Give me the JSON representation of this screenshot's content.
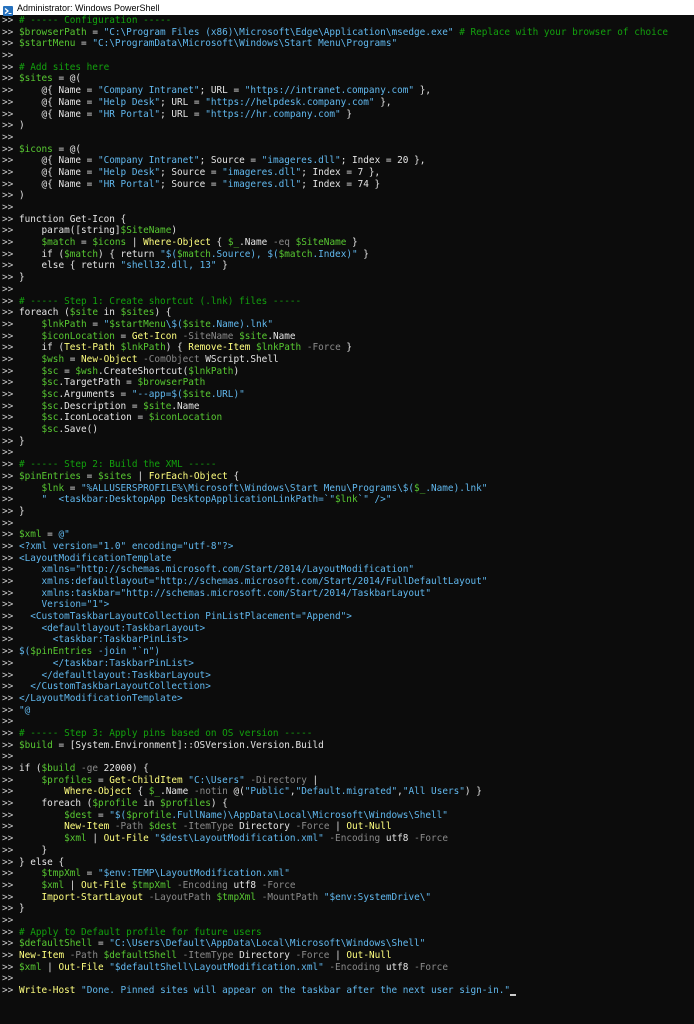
{
  "window": {
    "title": "Administrator: Windows PowerShell",
    "icon": "powershell-icon"
  },
  "console": {
    "prompt": ">> ",
    "lines": [
      [
        [
          "c",
          "# ----- Configuration -----"
        ]
      ],
      [
        [
          "v",
          "$browserPath"
        ],
        [
          "t",
          " = "
        ],
        [
          "s",
          "\"C:\\Program Files (x86)\\Microsoft\\Edge\\Application\\msedge.exe\""
        ],
        [
          "t",
          " "
        ],
        [
          "c",
          "# Replace with your browser of choice"
        ]
      ],
      [
        [
          "v",
          "$startMenu"
        ],
        [
          "t",
          " = "
        ],
        [
          "s",
          "\"C:\\ProgramData\\Microsoft\\Windows\\Start Menu\\Programs\""
        ]
      ],
      [],
      [
        [
          "c",
          "# Add sites here"
        ]
      ],
      [
        [
          "v",
          "$sites"
        ],
        [
          "t",
          " = @("
        ]
      ],
      [
        [
          "t",
          "    @{ Name = "
        ],
        [
          "s",
          "\"Company Intranet\""
        ],
        [
          "t",
          "; URL = "
        ],
        [
          "s",
          "\"https://intranet.company.com\""
        ],
        [
          "t",
          " },"
        ]
      ],
      [
        [
          "t",
          "    @{ Name = "
        ],
        [
          "s",
          "\"Help Desk\""
        ],
        [
          "t",
          "; URL = "
        ],
        [
          "s",
          "\"https://helpdesk.company.com\""
        ],
        [
          "t",
          " },"
        ]
      ],
      [
        [
          "t",
          "    @{ Name = "
        ],
        [
          "s",
          "\"HR Portal\""
        ],
        [
          "t",
          "; URL = "
        ],
        [
          "s",
          "\"https://hr.company.com\""
        ],
        [
          "t",
          " }"
        ]
      ],
      [
        [
          "t",
          ")"
        ]
      ],
      [],
      [
        [
          "v",
          "$icons"
        ],
        [
          "t",
          " = @("
        ]
      ],
      [
        [
          "t",
          "    @{ Name = "
        ],
        [
          "s",
          "\"Company Intranet\""
        ],
        [
          "t",
          "; Source = "
        ],
        [
          "s",
          "\"imageres.dll\""
        ],
        [
          "t",
          "; Index = 20 },"
        ]
      ],
      [
        [
          "t",
          "    @{ Name = "
        ],
        [
          "s",
          "\"Help Desk\""
        ],
        [
          "t",
          "; Source = "
        ],
        [
          "s",
          "\"imageres.dll\""
        ],
        [
          "t",
          "; Index = 7 },"
        ]
      ],
      [
        [
          "t",
          "    @{ Name = "
        ],
        [
          "s",
          "\"HR Portal\""
        ],
        [
          "t",
          "; Source = "
        ],
        [
          "s",
          "\"imageres.dll\""
        ],
        [
          "t",
          "; Index = 74 }"
        ]
      ],
      [
        [
          "t",
          ")"
        ]
      ],
      [],
      [
        [
          "t",
          "function Get-Icon {"
        ]
      ],
      [
        [
          "t",
          "    param([string]"
        ],
        [
          "v",
          "$SiteName"
        ],
        [
          "t",
          ")"
        ]
      ],
      [
        [
          "t",
          "    "
        ],
        [
          "v",
          "$match"
        ],
        [
          "t",
          " = "
        ],
        [
          "v",
          "$icons"
        ],
        [
          "t",
          " | "
        ],
        [
          "k",
          "Where-Object"
        ],
        [
          "t",
          " { "
        ],
        [
          "v",
          "$_"
        ],
        [
          "t",
          ".Name "
        ],
        [
          "n",
          "-eq"
        ],
        [
          "t",
          " "
        ],
        [
          "v",
          "$SiteName"
        ],
        [
          "t",
          " }"
        ]
      ],
      [
        [
          "t",
          "    if ("
        ],
        [
          "v",
          "$match"
        ],
        [
          "t",
          ") { return "
        ],
        [
          "s",
          "\"$("
        ],
        [
          "v",
          "$match"
        ],
        [
          "s",
          ".Source), $("
        ],
        [
          "v",
          "$match"
        ],
        [
          "s",
          ".Index)\""
        ],
        [
          "t",
          " }"
        ]
      ],
      [
        [
          "t",
          "    else { return "
        ],
        [
          "s",
          "\"shell32.dll, 13\""
        ],
        [
          "t",
          " }"
        ]
      ],
      [
        [
          "t",
          "}"
        ]
      ],
      [],
      [
        [
          "c",
          "# ----- Step 1: Create shortcut (.lnk) files -----"
        ]
      ],
      [
        [
          "t",
          "foreach ("
        ],
        [
          "v",
          "$site"
        ],
        [
          "t",
          " in "
        ],
        [
          "v",
          "$sites"
        ],
        [
          "t",
          ") {"
        ]
      ],
      [
        [
          "t",
          "    "
        ],
        [
          "v",
          "$lnkPath"
        ],
        [
          "t",
          " = "
        ],
        [
          "s",
          "\""
        ],
        [
          "v",
          "$startMenu"
        ],
        [
          "s",
          "\\$("
        ],
        [
          "v",
          "$site"
        ],
        [
          "s",
          ".Name).lnk\""
        ]
      ],
      [
        [
          "t",
          "    "
        ],
        [
          "v",
          "$iconLocation"
        ],
        [
          "t",
          " = "
        ],
        [
          "k",
          "Get-Icon"
        ],
        [
          "t",
          " "
        ],
        [
          "n",
          "-SiteName"
        ],
        [
          "t",
          " "
        ],
        [
          "v",
          "$site"
        ],
        [
          "t",
          ".Name"
        ]
      ],
      [
        [
          "t",
          "    if ("
        ],
        [
          "k",
          "Test-Path"
        ],
        [
          "t",
          " "
        ],
        [
          "v",
          "$lnkPath"
        ],
        [
          "t",
          ") { "
        ],
        [
          "k",
          "Remove-Item"
        ],
        [
          "t",
          " "
        ],
        [
          "v",
          "$lnkPath"
        ],
        [
          "t",
          " "
        ],
        [
          "n",
          "-Force"
        ],
        [
          "t",
          " }"
        ]
      ],
      [
        [
          "t",
          "    "
        ],
        [
          "v",
          "$wsh"
        ],
        [
          "t",
          " = "
        ],
        [
          "k",
          "New-Object"
        ],
        [
          "t",
          " "
        ],
        [
          "n",
          "-ComObject"
        ],
        [
          "t",
          " WScript.Shell"
        ]
      ],
      [
        [
          "t",
          "    "
        ],
        [
          "v",
          "$sc"
        ],
        [
          "t",
          " = "
        ],
        [
          "v",
          "$wsh"
        ],
        [
          "t",
          ".CreateShortcut("
        ],
        [
          "v",
          "$lnkPath"
        ],
        [
          "t",
          ")"
        ]
      ],
      [
        [
          "t",
          "    "
        ],
        [
          "v",
          "$sc"
        ],
        [
          "t",
          ".TargetPath = "
        ],
        [
          "v",
          "$browserPath"
        ]
      ],
      [
        [
          "t",
          "    "
        ],
        [
          "v",
          "$sc"
        ],
        [
          "t",
          ".Arguments = "
        ],
        [
          "s",
          "\"--app=$("
        ],
        [
          "v",
          "$site"
        ],
        [
          "s",
          ".URL)\""
        ]
      ],
      [
        [
          "t",
          "    "
        ],
        [
          "v",
          "$sc"
        ],
        [
          "t",
          ".Description = "
        ],
        [
          "v",
          "$site"
        ],
        [
          "t",
          ".Name"
        ]
      ],
      [
        [
          "t",
          "    "
        ],
        [
          "v",
          "$sc"
        ],
        [
          "t",
          ".IconLocation = "
        ],
        [
          "v",
          "$iconLocation"
        ]
      ],
      [
        [
          "t",
          "    "
        ],
        [
          "v",
          "$sc"
        ],
        [
          "t",
          ".Save()"
        ]
      ],
      [
        [
          "t",
          "}"
        ]
      ],
      [],
      [
        [
          "c",
          "# ----- Step 2: Build the XML -----"
        ]
      ],
      [
        [
          "v",
          "$pinEntries"
        ],
        [
          "t",
          " = "
        ],
        [
          "v",
          "$sites"
        ],
        [
          "t",
          " | "
        ],
        [
          "k",
          "ForEach-Object"
        ],
        [
          "t",
          " {"
        ]
      ],
      [
        [
          "t",
          "    "
        ],
        [
          "v",
          "$lnk"
        ],
        [
          "t",
          " = "
        ],
        [
          "s",
          "\"%ALLUSERSPROFILE%\\Microsoft\\Windows\\Start Menu\\Programs\\$("
        ],
        [
          "v",
          "$_"
        ],
        [
          "s",
          ".Name).lnk\""
        ]
      ],
      [
        [
          "t",
          "    "
        ],
        [
          "s",
          "\"  <taskbar:DesktopApp DesktopApplicationLinkPath=`\""
        ],
        [
          "v",
          "$lnk"
        ],
        [
          "s",
          "`\" />\""
        ]
      ],
      [
        [
          "t",
          "}"
        ]
      ],
      [],
      [
        [
          "v",
          "$xml"
        ],
        [
          "t",
          " = "
        ],
        [
          "s",
          "@\""
        ]
      ],
      [
        [
          "s",
          "<?xml version=\"1.0\" encoding=\"utf-8\"?>"
        ]
      ],
      [
        [
          "s",
          "<LayoutModificationTemplate"
        ]
      ],
      [
        [
          "s",
          "    xmlns=\"http://schemas.microsoft.com/Start/2014/LayoutModification\""
        ]
      ],
      [
        [
          "s",
          "    xmlns:defaultlayout=\"http://schemas.microsoft.com/Start/2014/FullDefaultLayout\""
        ]
      ],
      [
        [
          "s",
          "    xmlns:taskbar=\"http://schemas.microsoft.com/Start/2014/TaskbarLayout\""
        ]
      ],
      [
        [
          "s",
          "    Version=\"1\">"
        ]
      ],
      [
        [
          "s",
          "  <CustomTaskbarLayoutCollection PinListPlacement=\"Append\">"
        ]
      ],
      [
        [
          "s",
          "    <defaultlayout:TaskbarLayout>"
        ]
      ],
      [
        [
          "s",
          "      <taskbar:TaskbarPinList>"
        ]
      ],
      [
        [
          "s",
          "$("
        ],
        [
          "v",
          "$pinEntries"
        ],
        [
          "s",
          " -join \"`n\")"
        ]
      ],
      [
        [
          "s",
          "      </taskbar:TaskbarPinList>"
        ]
      ],
      [
        [
          "s",
          "    </defaultlayout:TaskbarLayout>"
        ]
      ],
      [
        [
          "s",
          "  </CustomTaskbarLayoutCollection>"
        ]
      ],
      [
        [
          "s",
          "</LayoutModificationTemplate>"
        ]
      ],
      [
        [
          "s",
          "\"@"
        ]
      ],
      [],
      [
        [
          "c",
          "# ----- Step 3: Apply pins based on OS version -----"
        ]
      ],
      [
        [
          "v",
          "$build"
        ],
        [
          "t",
          " = [System.Environment]::OSVersion.Version.Build"
        ]
      ],
      [],
      [
        [
          "t",
          "if ("
        ],
        [
          "v",
          "$build"
        ],
        [
          "t",
          " "
        ],
        [
          "n",
          "-ge"
        ],
        [
          "t",
          " 22000) {"
        ]
      ],
      [
        [
          "t",
          "    "
        ],
        [
          "v",
          "$profiles"
        ],
        [
          "t",
          " = "
        ],
        [
          "k",
          "Get-ChildItem"
        ],
        [
          "t",
          " "
        ],
        [
          "s",
          "\"C:\\Users\""
        ],
        [
          "t",
          " "
        ],
        [
          "n",
          "-Directory"
        ],
        [
          "t",
          " |"
        ]
      ],
      [
        [
          "t",
          "        "
        ],
        [
          "k",
          "Where-Object"
        ],
        [
          "t",
          " { "
        ],
        [
          "v",
          "$_"
        ],
        [
          "t",
          ".Name "
        ],
        [
          "n",
          "-notin"
        ],
        [
          "t",
          " @("
        ],
        [
          "s",
          "\"Public\""
        ],
        [
          "t",
          ","
        ],
        [
          "s",
          "\"Default.migrated\""
        ],
        [
          "t",
          ","
        ],
        [
          "s",
          "\"All Users\""
        ],
        [
          "t",
          ") }"
        ]
      ],
      [
        [
          "t",
          "    foreach ("
        ],
        [
          "v",
          "$profile"
        ],
        [
          "t",
          " in "
        ],
        [
          "v",
          "$profiles"
        ],
        [
          "t",
          ") {"
        ]
      ],
      [
        [
          "t",
          "        "
        ],
        [
          "v",
          "$dest"
        ],
        [
          "t",
          " = "
        ],
        [
          "s",
          "\"$("
        ],
        [
          "v",
          "$profile"
        ],
        [
          "s",
          ".FullName)\\AppData\\Local\\Microsoft\\Windows\\Shell\""
        ]
      ],
      [
        [
          "t",
          "        "
        ],
        [
          "k",
          "New-Item"
        ],
        [
          "t",
          " "
        ],
        [
          "n",
          "-Path"
        ],
        [
          "t",
          " "
        ],
        [
          "v",
          "$dest"
        ],
        [
          "t",
          " "
        ],
        [
          "n",
          "-ItemType"
        ],
        [
          "t",
          " Directory "
        ],
        [
          "n",
          "-Force"
        ],
        [
          "t",
          " | "
        ],
        [
          "k",
          "Out-Null"
        ]
      ],
      [
        [
          "t",
          "        "
        ],
        [
          "v",
          "$xml"
        ],
        [
          "t",
          " | "
        ],
        [
          "k",
          "Out-File"
        ],
        [
          "t",
          " "
        ],
        [
          "s",
          "\"$dest\\LayoutModification.xml\""
        ],
        [
          "t",
          " "
        ],
        [
          "n",
          "-Encoding"
        ],
        [
          "t",
          " utf8 "
        ],
        [
          "n",
          "-Force"
        ]
      ],
      [
        [
          "t",
          "    }"
        ]
      ],
      [
        [
          "t",
          "} else {"
        ]
      ],
      [
        [
          "t",
          "    "
        ],
        [
          "v",
          "$tmpXml"
        ],
        [
          "t",
          " = "
        ],
        [
          "s",
          "\"$env:TEMP\\LayoutModification.xml\""
        ]
      ],
      [
        [
          "t",
          "    "
        ],
        [
          "v",
          "$xml"
        ],
        [
          "t",
          " | "
        ],
        [
          "k",
          "Out-File"
        ],
        [
          "t",
          " "
        ],
        [
          "v",
          "$tmpXml"
        ],
        [
          "t",
          " "
        ],
        [
          "n",
          "-Encoding"
        ],
        [
          "t",
          " utf8 "
        ],
        [
          "n",
          "-Force"
        ]
      ],
      [
        [
          "t",
          "    "
        ],
        [
          "k",
          "Import-StartLayout"
        ],
        [
          "t",
          " "
        ],
        [
          "n",
          "-LayoutPath"
        ],
        [
          "t",
          " "
        ],
        [
          "v",
          "$tmpXml"
        ],
        [
          "t",
          " "
        ],
        [
          "n",
          "-MountPath"
        ],
        [
          "t",
          " "
        ],
        [
          "s",
          "\"$env:SystemDrive\\\""
        ]
      ],
      [
        [
          "t",
          "}"
        ]
      ],
      [],
      [
        [
          "c",
          "# Apply to Default profile for future users"
        ]
      ],
      [
        [
          "v",
          "$defaultShell"
        ],
        [
          "t",
          " = "
        ],
        [
          "s",
          "\"C:\\Users\\Default\\AppData\\Local\\Microsoft\\Windows\\Shell\""
        ]
      ],
      [
        [
          "k",
          "New-Item"
        ],
        [
          "t",
          " "
        ],
        [
          "n",
          "-Path"
        ],
        [
          "t",
          " "
        ],
        [
          "v",
          "$defaultShell"
        ],
        [
          "t",
          " "
        ],
        [
          "n",
          "-ItemType"
        ],
        [
          "t",
          " Directory "
        ],
        [
          "n",
          "-Force"
        ],
        [
          "t",
          " | "
        ],
        [
          "k",
          "Out-Null"
        ]
      ],
      [
        [
          "v",
          "$xml"
        ],
        [
          "t",
          " | "
        ],
        [
          "k",
          "Out-File"
        ],
        [
          "t",
          " "
        ],
        [
          "s",
          "\"$defaultShell\\LayoutModification.xml\""
        ],
        [
          "t",
          " "
        ],
        [
          "n",
          "-Encoding"
        ],
        [
          "t",
          " utf8 "
        ],
        [
          "n",
          "-Force"
        ]
      ],
      [],
      [
        [
          "k",
          "Write-Host"
        ],
        [
          "t",
          " "
        ],
        [
          "s",
          "\"Done. Pinned sites will appear on the taskbar after the next user sign-in.\""
        ]
      ]
    ]
  },
  "colors": {
    "background": "#0c0c0c",
    "comment": "#13a10e",
    "variable": "#58c832",
    "string": "#61b8ee",
    "cmdlet": "#ffff7f",
    "parameter": "#8a8a8a",
    "text": "#e5e5e5",
    "prompt": "#cccccc"
  }
}
